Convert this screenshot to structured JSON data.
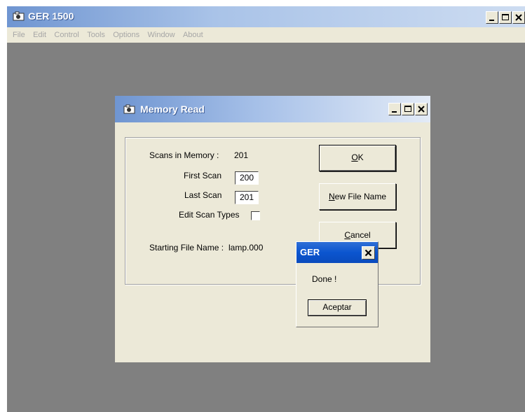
{
  "app": {
    "title": "GER 1500",
    "menu": [
      "File",
      "Edit",
      "Control",
      "Tools",
      "Options",
      "Window",
      "About"
    ]
  },
  "memory_dialog": {
    "title": "Memory Read",
    "scans_in_memory_label": "Scans in Memory :",
    "scans_in_memory_value": "201",
    "first_scan_label": "First Scan",
    "first_scan_value": "200",
    "last_scan_label": "Last Scan",
    "last_scan_value": "201",
    "edit_scan_types_label": "Edit Scan Types",
    "starting_file_name_label": "Starting File Name :",
    "starting_file_name_value": "lamp.000",
    "ok_button": {
      "mnemonic": "O",
      "rest": "K"
    },
    "new_file_name_button": {
      "mnemonic": "N",
      "rest": "ew File Name"
    },
    "cancel_button": {
      "mnemonic": "C",
      "rest": "ancel"
    }
  },
  "message_box": {
    "title": "GER",
    "text": "Done !",
    "button": "Aceptar"
  },
  "colors": {
    "face": "#ece9d8",
    "workspace": "#808080",
    "xp_blue": "#0b55cf"
  }
}
